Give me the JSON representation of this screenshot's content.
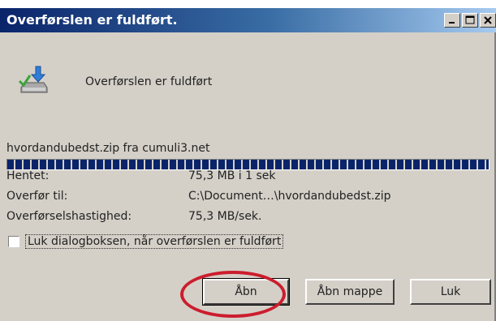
{
  "window": {
    "title": "Overførslen er fuldført.",
    "title_buttons": [
      "minimize-icon",
      "maximize-icon",
      "close-icon"
    ]
  },
  "header": {
    "icon": "download-complete-icon",
    "message": "Overførslen er fuldført"
  },
  "download": {
    "file_line": "hvordandubedst.zip fra cumuli3.net",
    "progress_percent": 100
  },
  "details": [
    {
      "label": "Hentet:",
      "value": "75,3 MB i 1 sek"
    },
    {
      "label": "Overfør til:",
      "value": "C:\\Document…\\hvordandubedst.zip"
    },
    {
      "label": "Overførselshastighed:",
      "value": "75,3 MB/sek."
    }
  ],
  "close_checkbox": {
    "label": "Luk dialogboksen, når overførslen er fuldført",
    "checked": false
  },
  "buttons": {
    "open": "Åbn",
    "open_folder": "Åbn mappe",
    "close": "Luk"
  },
  "annotation": {
    "color": "#cc1d2e",
    "target": "open"
  }
}
